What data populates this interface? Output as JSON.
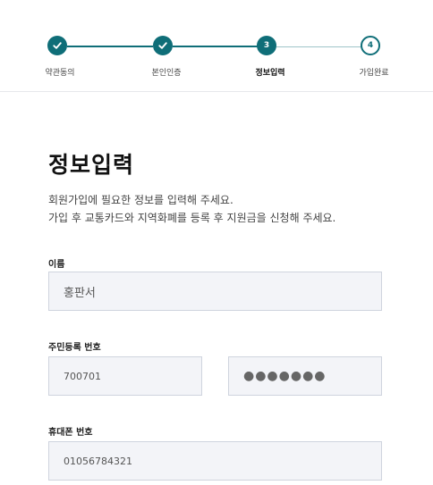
{
  "steps": [
    {
      "label": "약관동의",
      "state": "done"
    },
    {
      "label": "본인인증",
      "state": "done"
    },
    {
      "label": "정보입력",
      "number": "3",
      "state": "active"
    },
    {
      "label": "가입완료",
      "number": "4",
      "state": "todo"
    }
  ],
  "page": {
    "title": "정보입력",
    "description_line1": "회원가입에 필요한 정보를 입력해 주세요.",
    "description_line2": "가입 후 교통카드와 지역화폐를 등록 후 지원금을 신청해 주세요."
  },
  "form": {
    "name_label": "이름",
    "name_value": "홍판서",
    "rrn_label": "주민등록 번호",
    "rrn_front": "700701",
    "rrn_back_masked": "●●●●●●●",
    "phone_label": "휴대폰 번호",
    "phone_value": "01056784321"
  },
  "colors": {
    "accent": "#0f6e78",
    "field_bg": "#f3f4f8",
    "field_border": "#cfd4de"
  }
}
